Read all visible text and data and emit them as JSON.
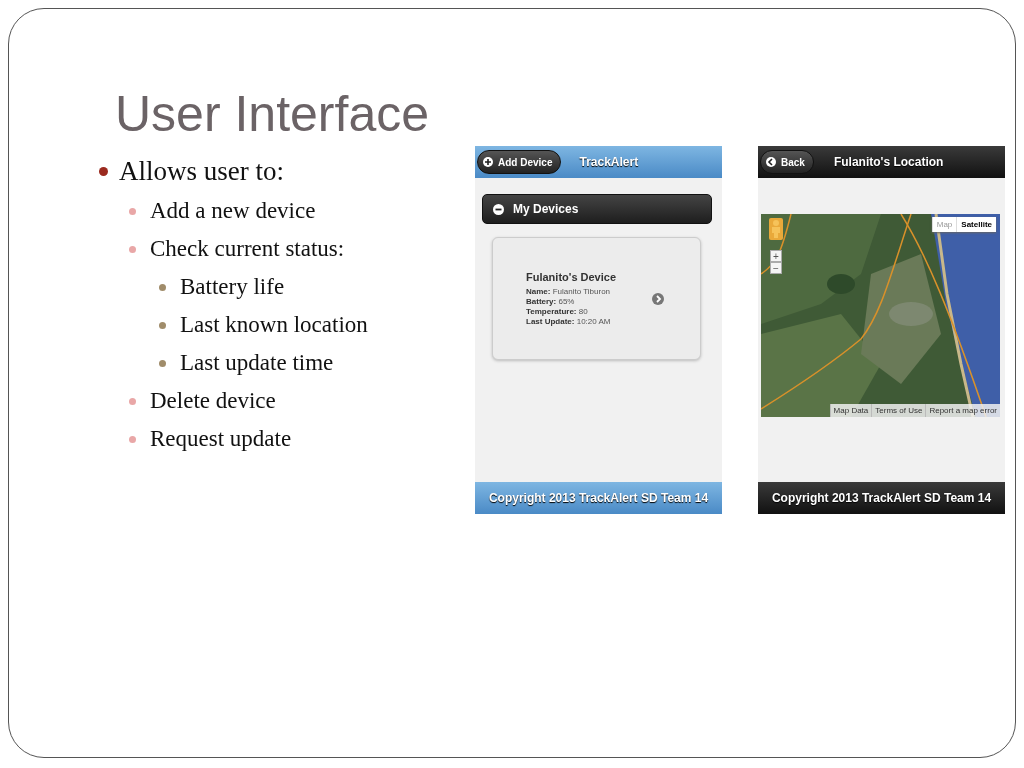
{
  "slide": {
    "title": "User Interface",
    "bullets": [
      {
        "text": "Allows user to:",
        "children": [
          {
            "text": "Add a new device"
          },
          {
            "text": "Check current status:",
            "children": [
              {
                "text": "Battery life"
              },
              {
                "text": "Last known location"
              },
              {
                "text": "Last update time"
              }
            ]
          },
          {
            "text": "Delete device"
          },
          {
            "text": "Request update"
          }
        ]
      }
    ]
  },
  "screens": [
    {
      "kind": "list",
      "header": {
        "button": "Add Device",
        "title": "TrackAlert"
      },
      "section": {
        "title": "My Devices",
        "expanded": true
      },
      "device": {
        "title": "Fulanito's Device",
        "fields": [
          {
            "label": "Name:",
            "value": "Fulanito Tiburon"
          },
          {
            "label": "Battery:",
            "value": "65%"
          },
          {
            "label": "Temperature:",
            "value": "80"
          },
          {
            "label": "Last Update:",
            "value": "10:20 AM"
          }
        ]
      },
      "footer": "Copyright 2013 TrackAlert SD Team 14"
    },
    {
      "kind": "map",
      "header": {
        "button": "Back",
        "title": "Fulanito's Location"
      },
      "map": {
        "types": [
          {
            "label": "Map",
            "selected": false
          },
          {
            "label": "Satellite",
            "selected": true
          }
        ],
        "zoom_in": "+",
        "zoom_out": "−",
        "links": [
          "Map Data",
          "Terms of Use",
          "Report a map error"
        ]
      },
      "footer": "Copyright 2013 TrackAlert SD Team 14"
    }
  ]
}
